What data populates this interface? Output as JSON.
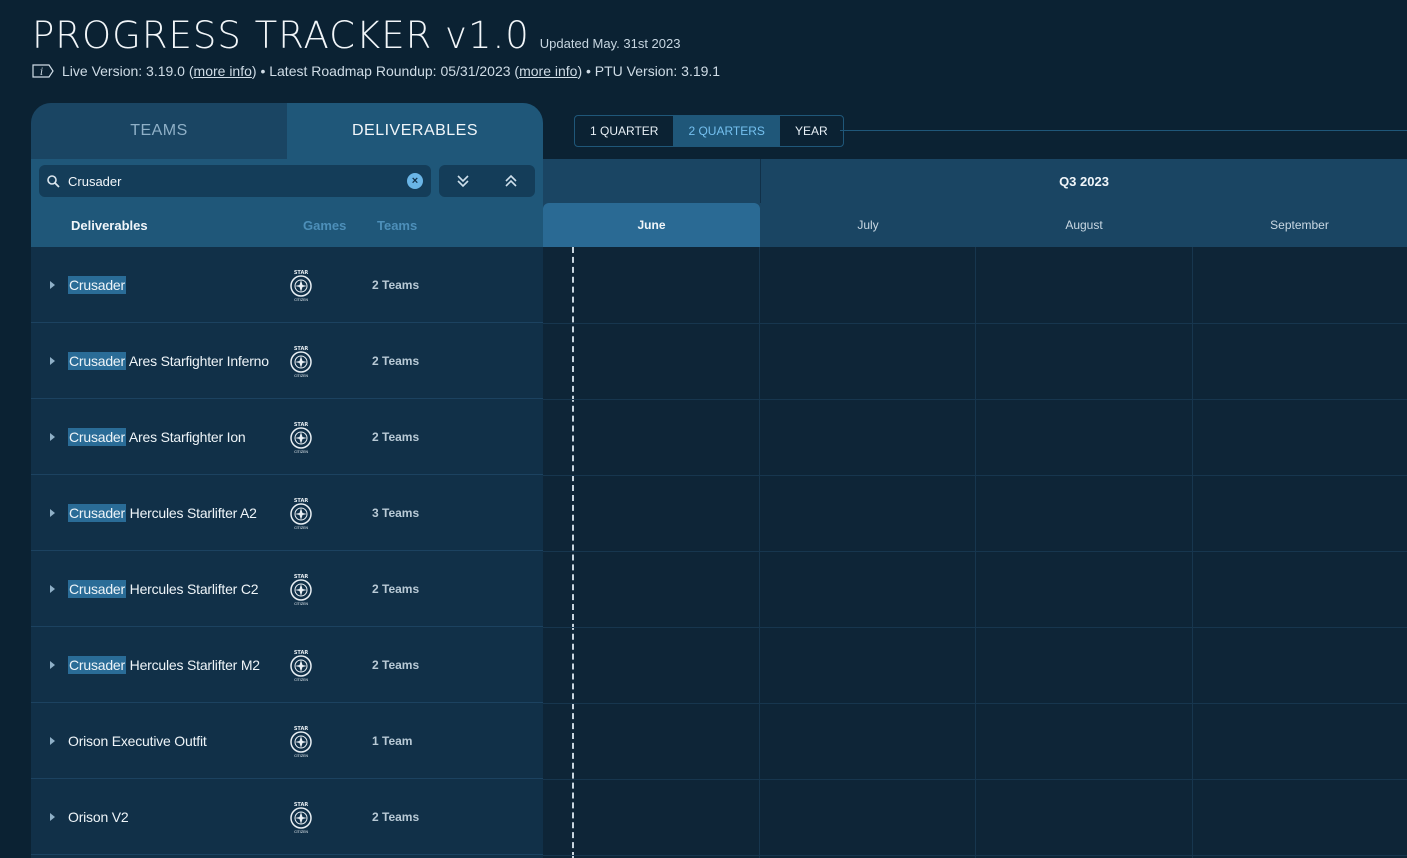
{
  "header": {
    "title": "PROGRESS TRACKER v1.0",
    "updated": "Updated May. 31st 2023",
    "live_version": "Live Version: 3.19.0 (",
    "more_info_1": "more info",
    "sep1": ") • Latest Roadmap Roundup: 05/31/2023 (",
    "more_info_2": "more info",
    "sep2": ") • PTU Version: 3.19.1"
  },
  "panel": {
    "tabs": [
      {
        "label": "TEAMS"
      },
      {
        "label": "DELIVERABLES"
      }
    ],
    "search": {
      "value": "Crusader",
      "placeholder": ""
    },
    "columns": {
      "deliverables": "Deliverables",
      "games": "Games",
      "teams": "Teams"
    },
    "rows": [
      {
        "highlight": "Crusader",
        "rest": "",
        "teams": "2 Teams"
      },
      {
        "highlight": "Crusader",
        "rest": " Ares Starfighter Inferno",
        "teams": "2 Teams"
      },
      {
        "highlight": "Crusader",
        "rest": " Ares Starfighter Ion",
        "teams": "2 Teams"
      },
      {
        "highlight": "Crusader",
        "rest": " Hercules Starlifter A2",
        "teams": "3 Teams"
      },
      {
        "highlight": "Crusader",
        "rest": " Hercules Starlifter C2",
        "teams": "2 Teams"
      },
      {
        "highlight": "Crusader",
        "rest": " Hercules Starlifter M2",
        "teams": "2 Teams"
      },
      {
        "highlight": "",
        "rest": "Orison Executive Outfit",
        "teams": "1 Team"
      },
      {
        "highlight": "",
        "rest": "Orison V2",
        "teams": "2 Teams"
      }
    ]
  },
  "timeline": {
    "ranges": [
      {
        "label": "1 QUARTER"
      },
      {
        "label": "2 QUARTERS"
      },
      {
        "label": "YEAR"
      }
    ],
    "quarter": "Q3 2023",
    "months": [
      {
        "label": "June"
      },
      {
        "label": "July"
      },
      {
        "label": "August"
      },
      {
        "label": "September"
      }
    ]
  },
  "colors": {
    "background": "#0b2233",
    "accent": "#2a6c97",
    "highlight_text": "#75c0ef"
  }
}
